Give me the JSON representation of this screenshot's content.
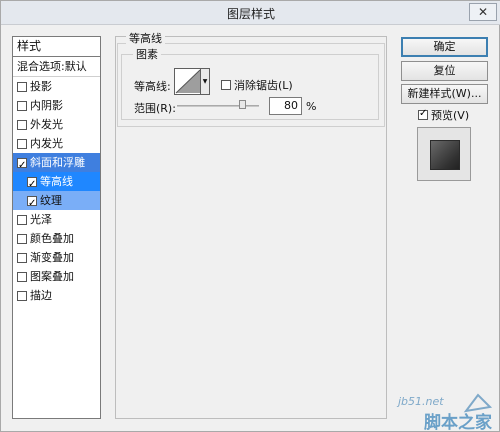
{
  "window": {
    "title": "图层样式",
    "close_glyph": "✕"
  },
  "sidebar": {
    "header": "样式",
    "blend_options": "混合选项:默认",
    "items": [
      {
        "label": "投影",
        "checked": false
      },
      {
        "label": "内阴影",
        "checked": false
      },
      {
        "label": "外发光",
        "checked": false
      },
      {
        "label": "内发光",
        "checked": false
      },
      {
        "label": "斜面和浮雕",
        "checked": true
      },
      {
        "label": "等高线",
        "checked": true
      },
      {
        "label": "纹理",
        "checked": true
      },
      {
        "label": "光泽",
        "checked": false
      },
      {
        "label": "颜色叠加",
        "checked": false
      },
      {
        "label": "渐变叠加",
        "checked": false
      },
      {
        "label": "图案叠加",
        "checked": false
      },
      {
        "label": "描边",
        "checked": false
      }
    ]
  },
  "contour_panel": {
    "section_title": "等高线",
    "group_title": "图素",
    "contour_label": "等高线:",
    "antialias_label": "消除锯齿(L)",
    "antialias_checked": false,
    "range_label": "范围(R):",
    "range_value": "80",
    "range_unit": "%",
    "range_slider_fraction": 0.8
  },
  "buttons": {
    "ok": "确定",
    "reset": "复位",
    "new_style": "新建样式(W)...",
    "preview_label": "预览(V)",
    "preview_checked": true
  },
  "watermark": {
    "url": "jb51.net",
    "text": "脚本之家"
  },
  "icons": {
    "close": "close-icon",
    "dropdown": "triangle-down-icon",
    "checkbox": "checkbox-icon"
  }
}
